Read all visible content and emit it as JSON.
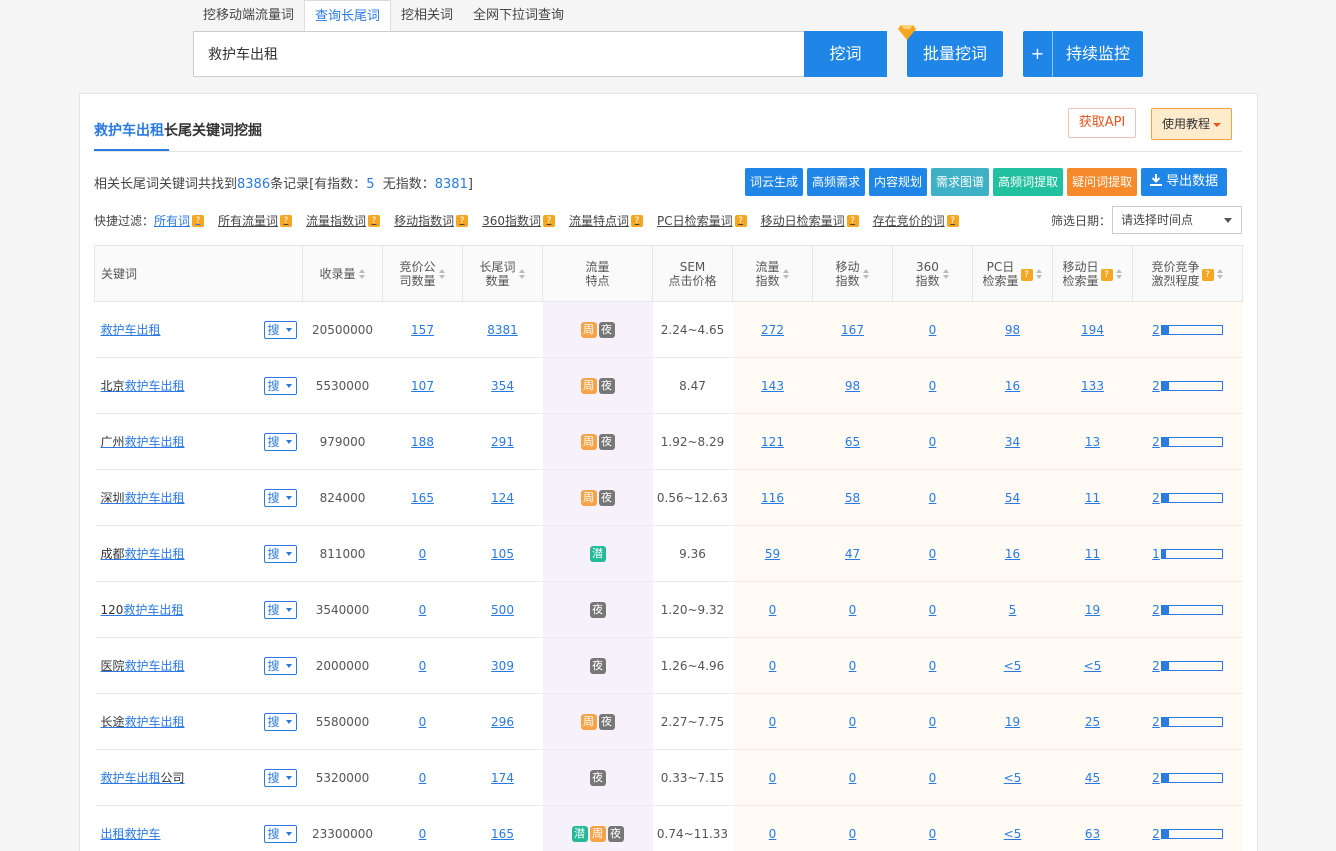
{
  "tabs": [
    "挖移动端流量词",
    "查询长尾词",
    "挖相关词",
    "全网下拉词查询"
  ],
  "search": {
    "value": "救护车出租",
    "dig_label": "挖词",
    "batch_label": "批量挖词",
    "monitor_plus": "+",
    "monitor_label": "持续监控"
  },
  "panel": {
    "title_keyword": "救护车出租",
    "title_rest": "长尾关键词挖掘",
    "api_label": "获取API",
    "tutorial_label": "使用教程"
  },
  "summary": {
    "prefix": "相关长尾词关键词共找到",
    "total": "8386",
    "mid": "条记录[有指数：",
    "with_index": "5",
    "mid2": "无指数：",
    "without_index": "8381",
    "suffix": "]"
  },
  "actions": [
    "词云生成",
    "高频需求",
    "内容规划",
    "需求图谱",
    "高频词提取",
    "疑问词提取",
    "导出数据"
  ],
  "filters": {
    "label": "快捷过滤：",
    "items": [
      "所有词",
      "所有流量词",
      "流量指数词",
      "移动指数词",
      "360指数词",
      "流量特点词",
      "PC日检索量词",
      "移动日检索量词",
      "存在竞价的词"
    ]
  },
  "date": {
    "label": "筛选日期：",
    "placeholder": "请选择时间点"
  },
  "columns": {
    "keyword": "关键词",
    "collected": "收录量",
    "bid_a": "竞价公",
    "bid_b": "司数量",
    "longtail_a": "长尾词",
    "longtail_b": "数量",
    "feature_a": "流量",
    "feature_b": "特点",
    "sem_a": "SEM",
    "sem_b": "点击价格",
    "traffic_a": "流量",
    "traffic_b": "指数",
    "mobile_a": "移动",
    "mobile_b": "指数",
    "i360_a": "360",
    "i360_b": "指数",
    "pc_a": "PC日",
    "pc_b": "检索量",
    "mday_a": "移动日",
    "mday_b": "检索量",
    "comp_a": "竞价竞争",
    "comp_b": "激烈程度"
  },
  "search_btn": "搜",
  "tag_labels": {
    "zhou": "周",
    "ye": "夜",
    "qian": "潜"
  },
  "rows": [
    {
      "pre": "",
      "kw": "救护车出租",
      "post": "",
      "collected": "20500000",
      "bid": "157",
      "longtail": "8381",
      "tags": [
        "zhou",
        "ye"
      ],
      "sem": "2.24~4.65",
      "traffic": "272",
      "mobile": "167",
      "i360": "0",
      "pc": "98",
      "mday": "194",
      "comp": "2",
      "comp_level": 0.12
    },
    {
      "pre": "北京",
      "kw": "救护车出租",
      "post": "",
      "collected": "5530000",
      "bid": "107",
      "longtail": "354",
      "tags": [
        "zhou",
        "ye"
      ],
      "sem": "8.47",
      "traffic": "143",
      "mobile": "98",
      "i360": "0",
      "pc": "16",
      "mday": "133",
      "comp": "2",
      "comp_level": 0.12
    },
    {
      "pre": "广州",
      "kw": "救护车出租",
      "post": "",
      "collected": "979000",
      "bid": "188",
      "longtail": "291",
      "tags": [
        "zhou",
        "ye"
      ],
      "sem": "1.92~8.29",
      "traffic": "121",
      "mobile": "65",
      "i360": "0",
      "pc": "34",
      "mday": "13",
      "comp": "2",
      "comp_level": 0.12
    },
    {
      "pre": "深圳",
      "kw": "救护车出租",
      "post": "",
      "collected": "824000",
      "bid": "165",
      "longtail": "124",
      "tags": [
        "zhou",
        "ye"
      ],
      "sem": "0.56~12.63",
      "traffic": "116",
      "mobile": "58",
      "i360": "0",
      "pc": "54",
      "mday": "11",
      "comp": "2",
      "comp_level": 0.12
    },
    {
      "pre": "成都",
      "kw": "救护车出租",
      "post": "",
      "collected": "811000",
      "bid": "0",
      "longtail": "105",
      "tags": [
        "qian"
      ],
      "sem": "9.36",
      "traffic": "59",
      "mobile": "47",
      "i360": "0",
      "pc": "16",
      "mday": "11",
      "comp": "1",
      "comp_level": 0.06
    },
    {
      "pre": "120",
      "kw": "救护车出租",
      "post": "",
      "collected": "3540000",
      "bid": "0",
      "longtail": "500",
      "tags": [
        "ye"
      ],
      "sem": "1.20~9.32",
      "traffic": "0",
      "mobile": "0",
      "i360": "0",
      "pc": "5",
      "mday": "19",
      "comp": "2",
      "comp_level": 0.12
    },
    {
      "pre": "医院",
      "kw": "救护车出租",
      "post": "",
      "collected": "2000000",
      "bid": "0",
      "longtail": "309",
      "tags": [
        "ye"
      ],
      "sem": "1.26~4.96",
      "traffic": "0",
      "mobile": "0",
      "i360": "0",
      "pc": "<5",
      "mday": "<5",
      "comp": "2",
      "comp_level": 0.12
    },
    {
      "pre": "长途",
      "kw": "救护车出租",
      "post": "",
      "collected": "5580000",
      "bid": "0",
      "longtail": "296",
      "tags": [
        "zhou",
        "ye"
      ],
      "sem": "2.27~7.75",
      "traffic": "0",
      "mobile": "0",
      "i360": "0",
      "pc": "19",
      "mday": "25",
      "comp": "2",
      "comp_level": 0.12
    },
    {
      "pre": "",
      "kw": "救护车出租",
      "post": "公司",
      "collected": "5320000",
      "bid": "0",
      "longtail": "174",
      "tags": [
        "ye"
      ],
      "sem": "0.33~7.15",
      "traffic": "0",
      "mobile": "0",
      "i360": "0",
      "pc": "<5",
      "mday": "45",
      "comp": "2",
      "comp_level": 0.12
    },
    {
      "pre": "",
      "kw": "出租救护车",
      "post": "",
      "collected": "23300000",
      "bid": "0",
      "longtail": "165",
      "tags": [
        "qian",
        "zhou",
        "ye"
      ],
      "sem": "0.74~11.33",
      "traffic": "0",
      "mobile": "0",
      "i360": "0",
      "pc": "<5",
      "mday": "63",
      "comp": "2",
      "comp_level": 0.12
    }
  ]
}
